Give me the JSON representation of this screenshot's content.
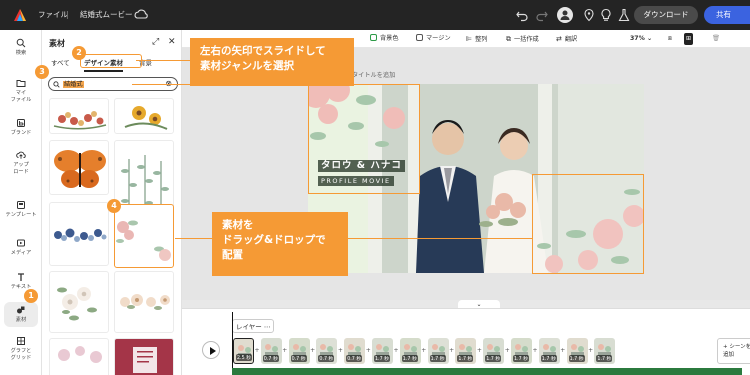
{
  "topbar": {
    "file_menu": "ファイル",
    "project_name": "結婚式ムービー",
    "download_label": "ダウンロード",
    "share_label": "共有"
  },
  "rail": [
    {
      "label": "検索",
      "icon": "search-icon"
    },
    {
      "label": "マイ\nファイル",
      "icon": "folder-icon"
    },
    {
      "label": "ブランド",
      "icon": "brand-icon"
    },
    {
      "label": "アップ\nロード",
      "icon": "upload-icon"
    },
    {
      "label": "テンプレート",
      "icon": "template-icon"
    },
    {
      "label": "メディア",
      "icon": "media-icon"
    },
    {
      "label": "テキスト",
      "icon": "text-icon"
    },
    {
      "label": "素材",
      "icon": "elements-icon"
    },
    {
      "label": "グラフと\nグリッド",
      "icon": "grid-icon"
    }
  ],
  "panel": {
    "title": "素材",
    "tabs": [
      "すべて",
      "デザイン素材",
      "背景"
    ],
    "search_value": "結婚式"
  },
  "toolbar": {
    "background_color": "背景色",
    "margin": "マージン",
    "align": "整列",
    "batch_create": "一括作成",
    "translate": "翻訳",
    "zoom": "37%"
  },
  "canvas": {
    "add_title_hint": "タイトルを追加",
    "slide_title": "タロウ & ハナコ",
    "slide_subtitle": "PROFILE MOVIE"
  },
  "callouts": {
    "c1": "左右の矢印でスライドして\n素材ジャンルを選択",
    "c2": "素材を\nドラッグ&ドロップで\n配置"
  },
  "badges": [
    "1",
    "2",
    "3",
    "4"
  ],
  "timeline": {
    "layer_label": "レイヤー ⋯",
    "add_scene": "+ シーンを\n追加",
    "clip_durations": [
      "2.5 秒",
      "0.7 秒",
      "0.7 秒",
      "0.7 秒",
      "0.7 秒",
      "1.7 秒",
      "1.7 秒",
      "1.7 秒",
      "1.7 秒",
      "1.7 秒",
      "1.7 秒",
      "1.7 秒",
      "1.7 秒",
      "1.7 秒"
    ]
  },
  "colors": {
    "accent_orange": "#f59a35",
    "share_blue": "#3b63e0",
    "topbar_bg": "#242424",
    "track_green": "#2b7a3e"
  }
}
